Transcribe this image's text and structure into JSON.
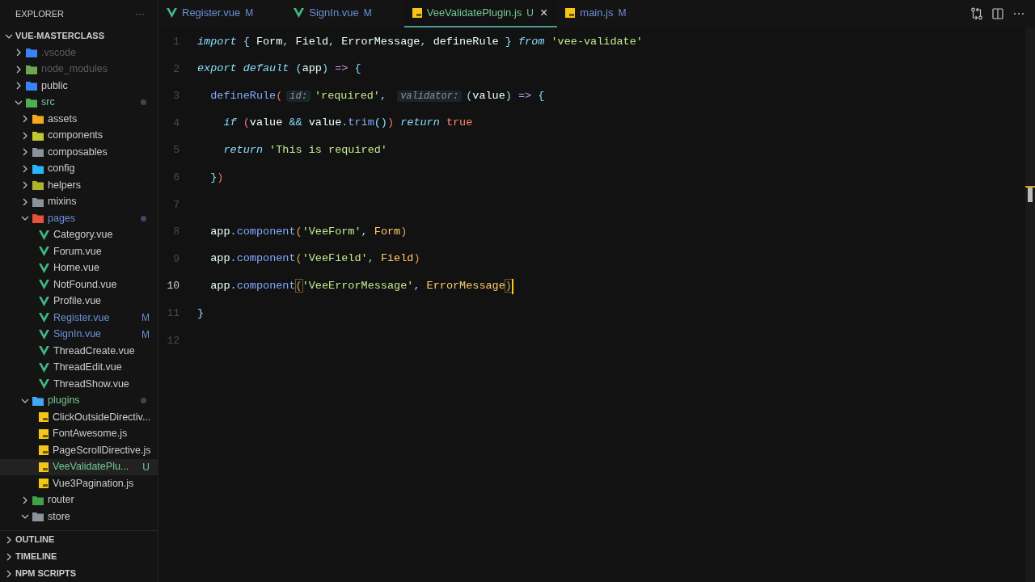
{
  "sidebar": {
    "title": "EXPLORER",
    "more": "···",
    "root": {
      "label": "VUE-MASTERCLASS",
      "expanded": true
    },
    "tree": [
      {
        "label": ".vscode",
        "kind": "folder",
        "color": "#3b82f6",
        "expanded": false,
        "dimmed": true,
        "modified": false,
        "untracked": false,
        "selected": false
      },
      {
        "label": "node_modules",
        "kind": "folder",
        "color": "#6aa84f",
        "expanded": false,
        "dimmed": true,
        "modified": false,
        "untracked": false,
        "selected": false
      },
      {
        "label": "public",
        "kind": "folder",
        "color": "#3b82f6",
        "expanded": false,
        "dimmed": false,
        "modified": false,
        "untracked": false,
        "selected": false
      },
      {
        "label": "src",
        "kind": "folder",
        "color": "#4caf50",
        "expanded": true,
        "dimmed": false,
        "modified": false,
        "untracked": true,
        "selected": false,
        "children": [
          {
            "label": "assets",
            "kind": "folder",
            "color": "#f5a623",
            "expanded": false,
            "dimmed": false,
            "modified": false,
            "untracked": false,
            "selected": false
          },
          {
            "label": "components",
            "kind": "folder",
            "color": "#c0ca33",
            "expanded": false,
            "dimmed": false,
            "modified": false,
            "untracked": false,
            "selected": false
          },
          {
            "label": "composables",
            "kind": "folder",
            "color": "#8a939c",
            "expanded": false,
            "dimmed": false,
            "modified": false,
            "untracked": false,
            "selected": false
          },
          {
            "label": "config",
            "kind": "folder",
            "color": "#29b6f6",
            "expanded": false,
            "dimmed": false,
            "modified": false,
            "untracked": false,
            "selected": false
          },
          {
            "label": "helpers",
            "kind": "folder",
            "color": "#afb42b",
            "expanded": false,
            "dimmed": false,
            "modified": false,
            "untracked": false,
            "selected": false
          },
          {
            "label": "mixins",
            "kind": "folder",
            "color": "#8a939c",
            "expanded": false,
            "dimmed": false,
            "modified": false,
            "untracked": false,
            "selected": false
          },
          {
            "label": "pages",
            "kind": "folder",
            "color": "#e5533d",
            "expanded": true,
            "dimmed": false,
            "modified": true,
            "untracked": false,
            "selected": false,
            "children": [
              {
                "label": "Category.vue",
                "kind": "vue",
                "dimmed": false,
                "modified": false,
                "untracked": false,
                "selected": false
              },
              {
                "label": "Forum.vue",
                "kind": "vue",
                "dimmed": false,
                "modified": false,
                "untracked": false,
                "selected": false
              },
              {
                "label": "Home.vue",
                "kind": "vue",
                "dimmed": false,
                "modified": false,
                "untracked": false,
                "selected": false
              },
              {
                "label": "NotFound.vue",
                "kind": "vue",
                "dimmed": false,
                "modified": false,
                "untracked": false,
                "selected": false
              },
              {
                "label": "Profile.vue",
                "kind": "vue",
                "dimmed": false,
                "modified": false,
                "untracked": false,
                "selected": false
              },
              {
                "label": "Register.vue",
                "kind": "vue",
                "dimmed": false,
                "modified": true,
                "untracked": false,
                "badge": "M",
                "selected": false
              },
              {
                "label": "SignIn.vue",
                "kind": "vue",
                "dimmed": false,
                "modified": true,
                "untracked": false,
                "badge": "M",
                "selected": false
              },
              {
                "label": "ThreadCreate.vue",
                "kind": "vue",
                "dimmed": false,
                "modified": false,
                "untracked": false,
                "selected": false
              },
              {
                "label": "ThreadEdit.vue",
                "kind": "vue",
                "dimmed": false,
                "modified": false,
                "untracked": false,
                "selected": false
              },
              {
                "label": "ThreadShow.vue",
                "kind": "vue",
                "dimmed": false,
                "modified": false,
                "untracked": false,
                "selected": false
              }
            ]
          },
          {
            "label": "plugins",
            "kind": "folder",
            "color": "#42a5f5",
            "expanded": true,
            "dimmed": false,
            "modified": false,
            "untracked": true,
            "selected": false,
            "children": [
              {
                "label": "ClickOutsideDirectiv...",
                "kind": "js",
                "dimmed": false,
                "modified": false,
                "untracked": false,
                "selected": false
              },
              {
                "label": "FontAwesome.js",
                "kind": "js",
                "dimmed": false,
                "modified": false,
                "untracked": false,
                "selected": false
              },
              {
                "label": "PageScrollDirective.js",
                "kind": "js",
                "dimmed": false,
                "modified": false,
                "untracked": false,
                "selected": false
              },
              {
                "label": "VeeValidatePlu...",
                "kind": "js",
                "dimmed": false,
                "modified": false,
                "untracked": true,
                "badge": "U",
                "selected": true
              },
              {
                "label": "Vue3Pagination.js",
                "kind": "js",
                "dimmed": false,
                "modified": false,
                "untracked": false,
                "selected": false
              }
            ]
          },
          {
            "label": "router",
            "kind": "folder",
            "color": "#43a047",
            "expanded": false,
            "dimmed": false,
            "modified": false,
            "untracked": false,
            "selected": false
          },
          {
            "label": "store",
            "kind": "folder",
            "color": "#8a939c",
            "expanded": true,
            "dimmed": false,
            "modified": false,
            "untracked": false,
            "selected": false
          }
        ]
      }
    ],
    "panels": [
      {
        "label": "OUTLINE",
        "expanded": false
      },
      {
        "label": "TIMELINE",
        "expanded": false
      },
      {
        "label": "NPM SCRIPTS",
        "expanded": false
      }
    ]
  },
  "tabs": [
    {
      "label": "Register.vue",
      "kind": "vue",
      "badge": "M",
      "modified": true,
      "untracked": false,
      "selected": false
    },
    {
      "label": "SignIn.vue",
      "kind": "vue",
      "badge": "M",
      "modified": true,
      "untracked": false,
      "selected": false
    },
    {
      "label": "VeeValidatePlugin.js",
      "kind": "js",
      "badge": "U",
      "modified": false,
      "untracked": true,
      "selected": true,
      "close": "×"
    },
    {
      "label": "main.js",
      "kind": "js",
      "badge": "M",
      "modified": true,
      "untracked": false,
      "selected": false
    }
  ],
  "editor": {
    "lines": [
      {
        "number": "1",
        "current": false,
        "tokens": [
          {
            "text": "import",
            "kind": "kw"
          },
          {
            "text": " { ",
            "kind": "punct"
          },
          {
            "text": "Form",
            "kind": "plain"
          },
          {
            "text": ", ",
            "kind": "punct"
          },
          {
            "text": "Field",
            "kind": "plain"
          },
          {
            "text": ", ",
            "kind": "punct"
          },
          {
            "text": "ErrorMessage",
            "kind": "plain"
          },
          {
            "text": ", ",
            "kind": "punct"
          },
          {
            "text": "defineRule",
            "kind": "plain"
          },
          {
            "text": " } ",
            "kind": "punct"
          },
          {
            "text": "from",
            "kind": "kw"
          },
          {
            "text": " 'vee-validate'",
            "kind": "str"
          }
        ]
      },
      {
        "number": "2",
        "current": false,
        "tokens": [
          {
            "text": "export default",
            "kind": "kw"
          },
          {
            "text": " (",
            "kind": "punct"
          },
          {
            "text": "app",
            "kind": "plain"
          },
          {
            "text": ") ",
            "kind": "punct"
          },
          {
            "text": "=>",
            "kind": "op"
          },
          {
            "text": " {",
            "kind": "punct"
          }
        ]
      },
      {
        "number": "3",
        "current": false,
        "tokens": [
          {
            "text": "  defineRule",
            "kind": "fn"
          },
          {
            "text": "(",
            "kind": "paren"
          },
          {
            "text": "id:",
            "kind": "hint"
          },
          {
            "text": "'required'",
            "kind": "str"
          },
          {
            "text": ", ",
            "kind": "punct"
          },
          {
            "text": "validator:",
            "kind": "hint"
          },
          {
            "text": "(",
            "kind": "punct"
          },
          {
            "text": "value",
            "kind": "plain"
          },
          {
            "text": ") ",
            "kind": "punct"
          },
          {
            "text": "=>",
            "kind": "op"
          },
          {
            "text": " {",
            "kind": "punct"
          }
        ]
      },
      {
        "number": "4",
        "current": false,
        "tokens": [
          {
            "text": "    if",
            "kind": "kw"
          },
          {
            "text": " (",
            "kind": "paren"
          },
          {
            "text": "value",
            "kind": "plain"
          },
          {
            "text": " && ",
            "kind": "punct"
          },
          {
            "text": "value",
            "kind": "plain"
          },
          {
            "text": ".",
            "kind": "punct"
          },
          {
            "text": "trim",
            "kind": "fn"
          },
          {
            "text": "()",
            "kind": "punct"
          },
          {
            "text": ")",
            "kind": "paren"
          },
          {
            "text": " return",
            "kind": "kw"
          },
          {
            "text": " true",
            "kind": "bool"
          }
        ]
      },
      {
        "number": "5",
        "current": false,
        "tokens": [
          {
            "text": "    return",
            "kind": "kw"
          },
          {
            "text": " 'This is required'",
            "kind": "str"
          }
        ]
      },
      {
        "number": "6",
        "current": false,
        "tokens": [
          {
            "text": "  }",
            "kind": "punct"
          },
          {
            "text": ")",
            "kind": "paren"
          }
        ]
      },
      {
        "number": "7",
        "current": false
      },
      {
        "number": "8",
        "current": false,
        "tokens": [
          {
            "text": "  app",
            "kind": "plain"
          },
          {
            "text": ".",
            "kind": "punct"
          },
          {
            "text": "component",
            "kind": "fn"
          },
          {
            "text": "(",
            "kind": "bracket"
          },
          {
            "text": "'VeeForm'",
            "kind": "str"
          },
          {
            "text": ", ",
            "kind": "punct"
          },
          {
            "text": "Form",
            "kind": "cls"
          },
          {
            "text": ")",
            "kind": "bracket"
          }
        ]
      },
      {
        "number": "9",
        "current": false,
        "tokens": [
          {
            "text": "  app",
            "kind": "plain"
          },
          {
            "text": ".",
            "kind": "punct"
          },
          {
            "text": "component",
            "kind": "fn"
          },
          {
            "text": "(",
            "kind": "bracket"
          },
          {
            "text": "'VeeField'",
            "kind": "str"
          },
          {
            "text": ", ",
            "kind": "punct"
          },
          {
            "text": "Field",
            "kind": "cls"
          },
          {
            "text": ")",
            "kind": "bracket"
          }
        ]
      },
      {
        "number": "10",
        "current": true,
        "tokens": [
          {
            "text": "  app",
            "kind": "plain"
          },
          {
            "text": ".",
            "kind": "punct"
          },
          {
            "text": "component",
            "kind": "fn"
          },
          {
            "text": "(",
            "kind": "match"
          },
          {
            "text": "'VeeErrorMessage'",
            "kind": "str"
          },
          {
            "text": ", ",
            "kind": "punct"
          },
          {
            "text": "ErrorMessage",
            "kind": "cls"
          },
          {
            "text": ")",
            "kind": "match"
          }
        ]
      },
      {
        "number": "11",
        "current": false,
        "tokens": [
          {
            "text": "}",
            "kind": "punct"
          }
        ]
      },
      {
        "number": "12",
        "current": false
      }
    ]
  }
}
